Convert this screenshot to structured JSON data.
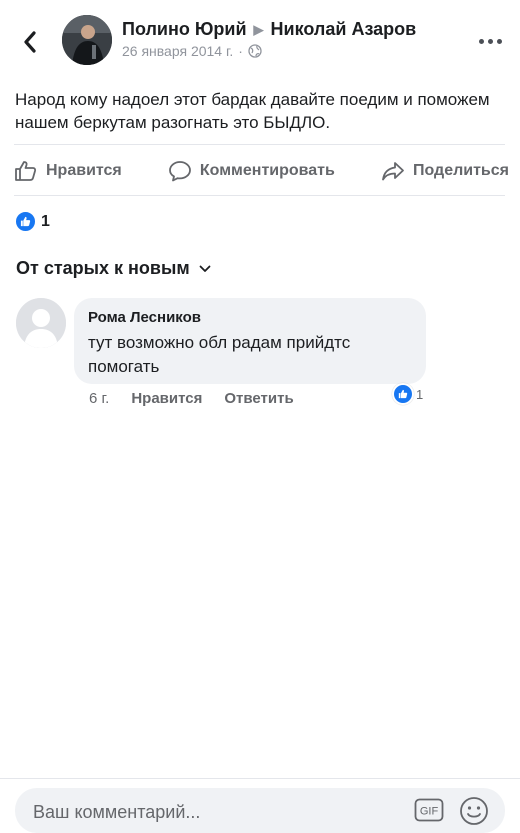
{
  "post": {
    "author": "Полино Юрий",
    "recipient": "Николай Азаров",
    "date": "26 января 2014 г.",
    "separator": "·",
    "text": "Народ кому надоел этот бардак давайте поедим и поможем нашем беркутам разогнать это БЫДЛО.",
    "reaction_count": "1",
    "privacy_icon": "globe-icon"
  },
  "actions": {
    "like": "Нравится",
    "comment": "Комментировать",
    "share": "Поделиться"
  },
  "sort": {
    "label": "От старых к новым"
  },
  "comments": [
    {
      "author": "Рома Лесников",
      "text": "тут возможно обл радам прийдтс помогать",
      "time": "6 г.",
      "like_label": "Нравится",
      "reply_label": "Ответить",
      "reaction_count": "1"
    }
  ],
  "composer": {
    "placeholder": "Ваш комментарий...",
    "gif_label": "GIF"
  },
  "colors": {
    "accent": "#1877f2",
    "bubble": "#f0f2f5",
    "secondary_text": "#65676b"
  }
}
